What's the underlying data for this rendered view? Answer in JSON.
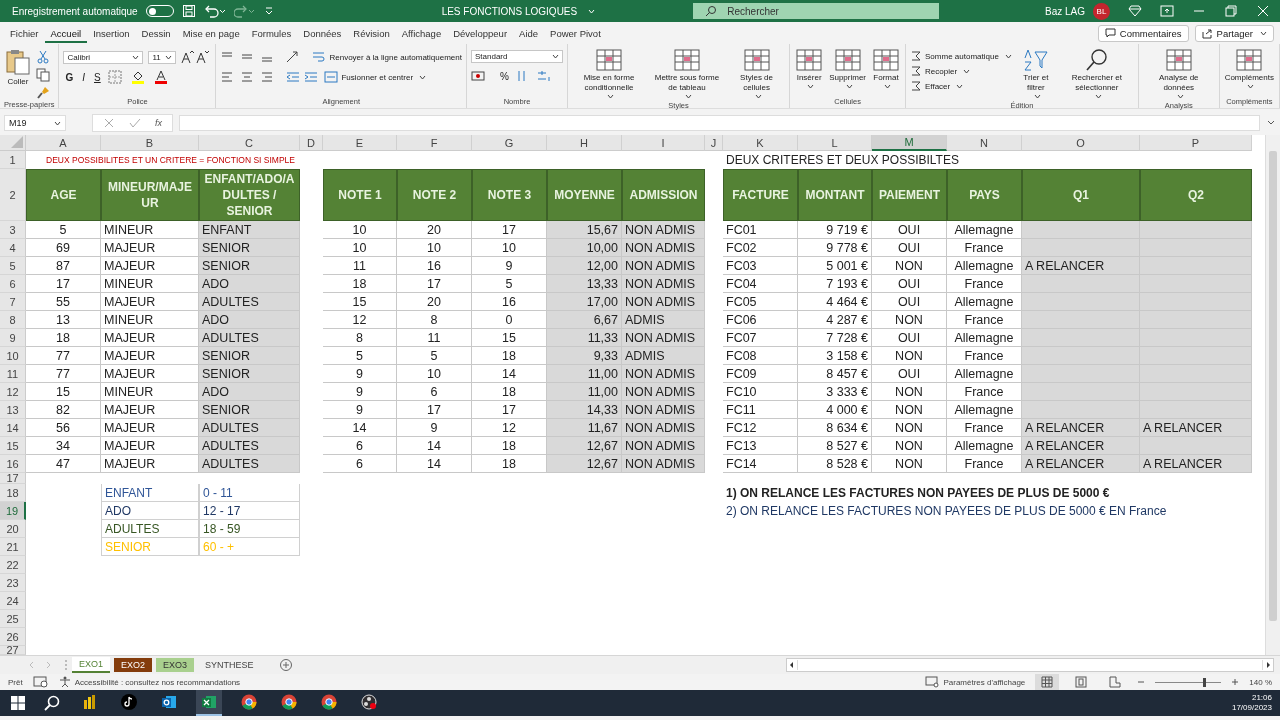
{
  "titlebar": {
    "autosave_label": "Enregistrement automatique",
    "autosave_on": false,
    "title": "LES FONCTIONS LOGIQUES",
    "search_placeholder": "Rechercher",
    "user": "Baz LAG",
    "initials": "BL"
  },
  "menu_tabs": [
    {
      "label": "Fichier",
      "selected": false
    },
    {
      "label": "Accueil",
      "selected": true
    },
    {
      "label": "Insertion",
      "selected": false
    },
    {
      "label": "Dessin",
      "selected": false
    },
    {
      "label": "Mise en page",
      "selected": false
    },
    {
      "label": "Formules",
      "selected": false
    },
    {
      "label": "Données",
      "selected": false
    },
    {
      "label": "Révision",
      "selected": false
    },
    {
      "label": "Affichage",
      "selected": false
    },
    {
      "label": "Développeur",
      "selected": false
    },
    {
      "label": "Aide",
      "selected": false
    },
    {
      "label": "Power Pivot",
      "selected": false
    }
  ],
  "comments_button": "Commentaires",
  "share_button": "Partager",
  "ribbon": [
    {
      "label": "Presse-papiers",
      "kind": "clipboard",
      "items": [
        "Coller"
      ]
    },
    {
      "label": "Police",
      "kind": "font",
      "font": "Calibri",
      "size": "11",
      "styles": [
        "G",
        "I",
        "S"
      ]
    },
    {
      "label": "Alignement",
      "kind": "align",
      "items": [
        "Renvoyer à la ligne automatiquement",
        "Fusionner et centrer"
      ]
    },
    {
      "label": "Nombre",
      "kind": "number",
      "format": "Standard",
      "percent": "%"
    },
    {
      "label": "Styles",
      "kind": "large",
      "items": [
        "Mise en forme conditionnelle",
        "Mettre sous forme de tableau",
        "Styles de cellules"
      ]
    },
    {
      "label": "Cellules",
      "kind": "large",
      "items": [
        "Insérer",
        "Supprimer",
        "Format"
      ]
    },
    {
      "label": "Édition",
      "kind": "edit",
      "small": [
        "Somme automatique",
        "Recopier",
        "Effacer"
      ],
      "items": [
        "Trier et filtrer",
        "Rechercher et sélectionner"
      ]
    },
    {
      "label": "Analysis",
      "kind": "large",
      "items": [
        "Analyse de données"
      ]
    },
    {
      "label": "Compléments",
      "kind": "large",
      "items": [
        "Compléments"
      ]
    }
  ],
  "formula_bar": {
    "name_box": "M19",
    "fx": "fx"
  },
  "sheet": {
    "columns": [
      {
        "label": "A",
        "selected": false
      },
      {
        "label": "B",
        "selected": false
      },
      {
        "label": "C",
        "selected": false
      },
      {
        "label": "D",
        "selected": false
      },
      {
        "label": "E",
        "selected": false
      },
      {
        "label": "F",
        "selected": false
      },
      {
        "label": "G",
        "selected": false
      },
      {
        "label": "H",
        "selected": false
      },
      {
        "label": "I",
        "selected": false
      },
      {
        "label": "J",
        "selected": false
      },
      {
        "label": "K",
        "selected": false
      },
      {
        "label": "L",
        "selected": false
      },
      {
        "label": "M",
        "selected": true
      },
      {
        "label": "N",
        "selected": false
      },
      {
        "label": "O",
        "selected": false
      },
      {
        "label": "P",
        "selected": false
      }
    ],
    "rows": [
      {
        "label": "1",
        "selected": false
      },
      {
        "label": "2",
        "selected": false
      },
      {
        "label": "3",
        "selected": false
      },
      {
        "label": "4",
        "selected": false
      },
      {
        "label": "5",
        "selected": false
      },
      {
        "label": "6",
        "selected": false
      },
      {
        "label": "7",
        "selected": false
      },
      {
        "label": "8",
        "selected": false
      },
      {
        "label": "9",
        "selected": false
      },
      {
        "label": "10",
        "selected": false
      },
      {
        "label": "11",
        "selected": false
      },
      {
        "label": "12",
        "selected": false
      },
      {
        "label": "13",
        "selected": false
      },
      {
        "label": "14",
        "selected": false
      },
      {
        "label": "15",
        "selected": false
      },
      {
        "label": "16",
        "selected": false
      },
      {
        "label": "17",
        "selected": false
      },
      {
        "label": "18",
        "selected": false
      },
      {
        "label": "19",
        "selected": true
      },
      {
        "label": "20",
        "selected": false
      },
      {
        "label": "21",
        "selected": false
      },
      {
        "label": "22",
        "selected": false
      },
      {
        "label": "23",
        "selected": false
      },
      {
        "label": "24",
        "selected": false
      },
      {
        "label": "25",
        "selected": false
      },
      {
        "label": "26",
        "selected": false
      },
      {
        "label": "27",
        "selected": false
      }
    ],
    "title_left": "DEUX POSSIBILITES ET UN CRITERE = FONCTION SI SIMPLE",
    "title_right": "DEUX CRITERES ET DEUX POSSIBILTES",
    "tables": [
      {
        "columns": [
          {
            "header": "AGE",
            "shaded": false
          },
          {
            "header": "MINEUR/MAJEUR",
            "shaded": false
          },
          {
            "header": "ENFANT/ADO/ADULTES / SENIOR",
            "shaded": true
          }
        ],
        "rows": [
          [
            "5",
            "MINEUR",
            "ENFANT"
          ],
          [
            "69",
            "MAJEUR",
            "SENIOR"
          ],
          [
            "87",
            "MAJEUR",
            "SENIOR"
          ],
          [
            "17",
            "MINEUR",
            "ADO"
          ],
          [
            "55",
            "MAJEUR",
            "ADULTES"
          ],
          [
            "13",
            "MINEUR",
            "ADO"
          ],
          [
            "18",
            "MAJEUR",
            "ADULTES"
          ],
          [
            "77",
            "MAJEUR",
            "SENIOR"
          ],
          [
            "77",
            "MAJEUR",
            "SENIOR"
          ],
          [
            "15",
            "MINEUR",
            "ADO"
          ],
          [
            "82",
            "MAJEUR",
            "SENIOR"
          ],
          [
            "56",
            "MAJEUR",
            "ADULTES"
          ],
          [
            "34",
            "MAJEUR",
            "ADULTES"
          ],
          [
            "47",
            "MAJEUR",
            "ADULTES"
          ]
        ]
      },
      {
        "columns": [
          {
            "header": "NOTE 1",
            "shaded": false
          },
          {
            "header": "NOTE 2",
            "shaded": false
          },
          {
            "header": "NOTE 3",
            "shaded": false
          },
          {
            "header": "MOYENNE",
            "shaded": true
          },
          {
            "header": "ADMISSION",
            "shaded": true
          }
        ],
        "rows": [
          [
            "10",
            "20",
            "17",
            "15,67",
            "NON ADMIS"
          ],
          [
            "10",
            "10",
            "10",
            "10,00",
            "NON ADMIS"
          ],
          [
            "11",
            "16",
            "9",
            "12,00",
            "NON ADMIS"
          ],
          [
            "18",
            "17",
            "5",
            "13,33",
            "NON ADMIS"
          ],
          [
            "15",
            "20",
            "16",
            "17,00",
            "NON ADMIS"
          ],
          [
            "12",
            "8",
            "0",
            "6,67",
            "ADMIS"
          ],
          [
            "8",
            "11",
            "15",
            "11,33",
            "NON ADMIS"
          ],
          [
            "5",
            "5",
            "18",
            "9,33",
            "ADMIS"
          ],
          [
            "9",
            "10",
            "14",
            "11,00",
            "NON ADMIS"
          ],
          [
            "9",
            "6",
            "18",
            "11,00",
            "NON ADMIS"
          ],
          [
            "9",
            "17",
            "17",
            "14,33",
            "NON ADMIS"
          ],
          [
            "14",
            "9",
            "12",
            "11,67",
            "NON ADMIS"
          ],
          [
            "6",
            "14",
            "18",
            "12,67",
            "NON ADMIS"
          ],
          [
            "6",
            "14",
            "18",
            "12,67",
            "NON ADMIS"
          ]
        ]
      },
      {
        "columns": [
          {
            "header": "FACTURE",
            "shaded": false
          },
          {
            "header": "MONTANT",
            "shaded": false
          },
          {
            "header": "PAIEMENT",
            "shaded": false
          },
          {
            "header": "PAYS",
            "shaded": false
          },
          {
            "header": "Q1",
            "shaded": true
          },
          {
            "header": "Q2",
            "shaded": true
          }
        ],
        "rows": [
          [
            "FC01",
            "9 719 €",
            "OUI",
            "Allemagne",
            null,
            null
          ],
          [
            "FC02",
            "9 778 €",
            "OUI",
            "France",
            null,
            null
          ],
          [
            "FC03",
            "5 001 €",
            "NON",
            "Allemagne",
            "A RELANCER",
            null
          ],
          [
            "FC04",
            "7 193 €",
            "OUI",
            "France",
            null,
            null
          ],
          [
            "FC05",
            "4 464 €",
            "OUI",
            "Allemagne",
            null,
            null
          ],
          [
            "FC06",
            "4 287 €",
            "NON",
            "France",
            null,
            null
          ],
          [
            "FC07",
            "7 728 €",
            "OUI",
            "Allemagne",
            null,
            null
          ],
          [
            "FC08",
            "3 158 €",
            "NON",
            "France",
            null,
            null
          ],
          [
            "FC09",
            "8 457 €",
            "OUI",
            "Allemagne",
            null,
            null
          ],
          [
            "FC10",
            "3 333 €",
            "NON",
            "France",
            null,
            null
          ],
          [
            "FC11",
            "4 000 €",
            "NON",
            "Allemagne",
            null,
            null
          ],
          [
            "FC12",
            "8 634 €",
            "NON",
            "France",
            "A RELANCER",
            "A RELANCER"
          ],
          [
            "FC13",
            "8 527 €",
            "NON",
            "Allemagne",
            "A RELANCER",
            null
          ],
          [
            "FC14",
            "8 528 €",
            "NON",
            "France",
            "A RELANCER",
            "A RELANCER"
          ]
        ]
      }
    ],
    "legend": [
      {
        "label": "ENFANT",
        "range": "0 - 11",
        "color": "#2f5597"
      },
      {
        "label": "ADO",
        "range": "12 - 17",
        "color": "#203864"
      },
      {
        "label": "ADULTES",
        "range": "18 - 59",
        "color": "#375623"
      },
      {
        "label": "SENIOR",
        "range": "60 - +",
        "color": "#ffc000"
      }
    ],
    "notes": [
      {
        "text": "1) ON RELANCE LES FACTURES NON PAYEES DE PLUS DE 5000 €",
        "bold": true
      },
      {
        "text": "2) ON RELANCE LES FACTURES NON PAYEES DE PLUS DE 5000 € EN France",
        "bold": false
      }
    ]
  },
  "sheet_tabs": [
    {
      "label": "EXO1",
      "selected": true,
      "color": "#548235"
    },
    {
      "label": "EXO2",
      "selected": false,
      "color": "#843c0c"
    },
    {
      "label": "EXO3",
      "selected": false,
      "color": "#a9d08e"
    },
    {
      "label": "SYNTHESE",
      "selected": false
    }
  ],
  "status_bar": {
    "ready": "Prêt",
    "accessibility": "Accessibilité : consultez nos recommandations",
    "display_settings": "Paramètres d'affichage",
    "zoom": "140 %",
    "zoom_level": {
      "level": 0.73
    }
  },
  "taskbar": {
    "apps": [
      {
        "kind": "powerbi",
        "active": false
      },
      {
        "kind": "tiktok",
        "active": false
      },
      {
        "kind": "outlook",
        "active": false
      },
      {
        "kind": "excel",
        "active": true
      },
      {
        "kind": "chrome",
        "active": false
      },
      {
        "kind": "chrome",
        "active": false
      },
      {
        "kind": "chrome",
        "active": false
      },
      {
        "kind": "obs",
        "active": false
      }
    ],
    "time": "21:06",
    "date": "17/09/2023"
  }
}
